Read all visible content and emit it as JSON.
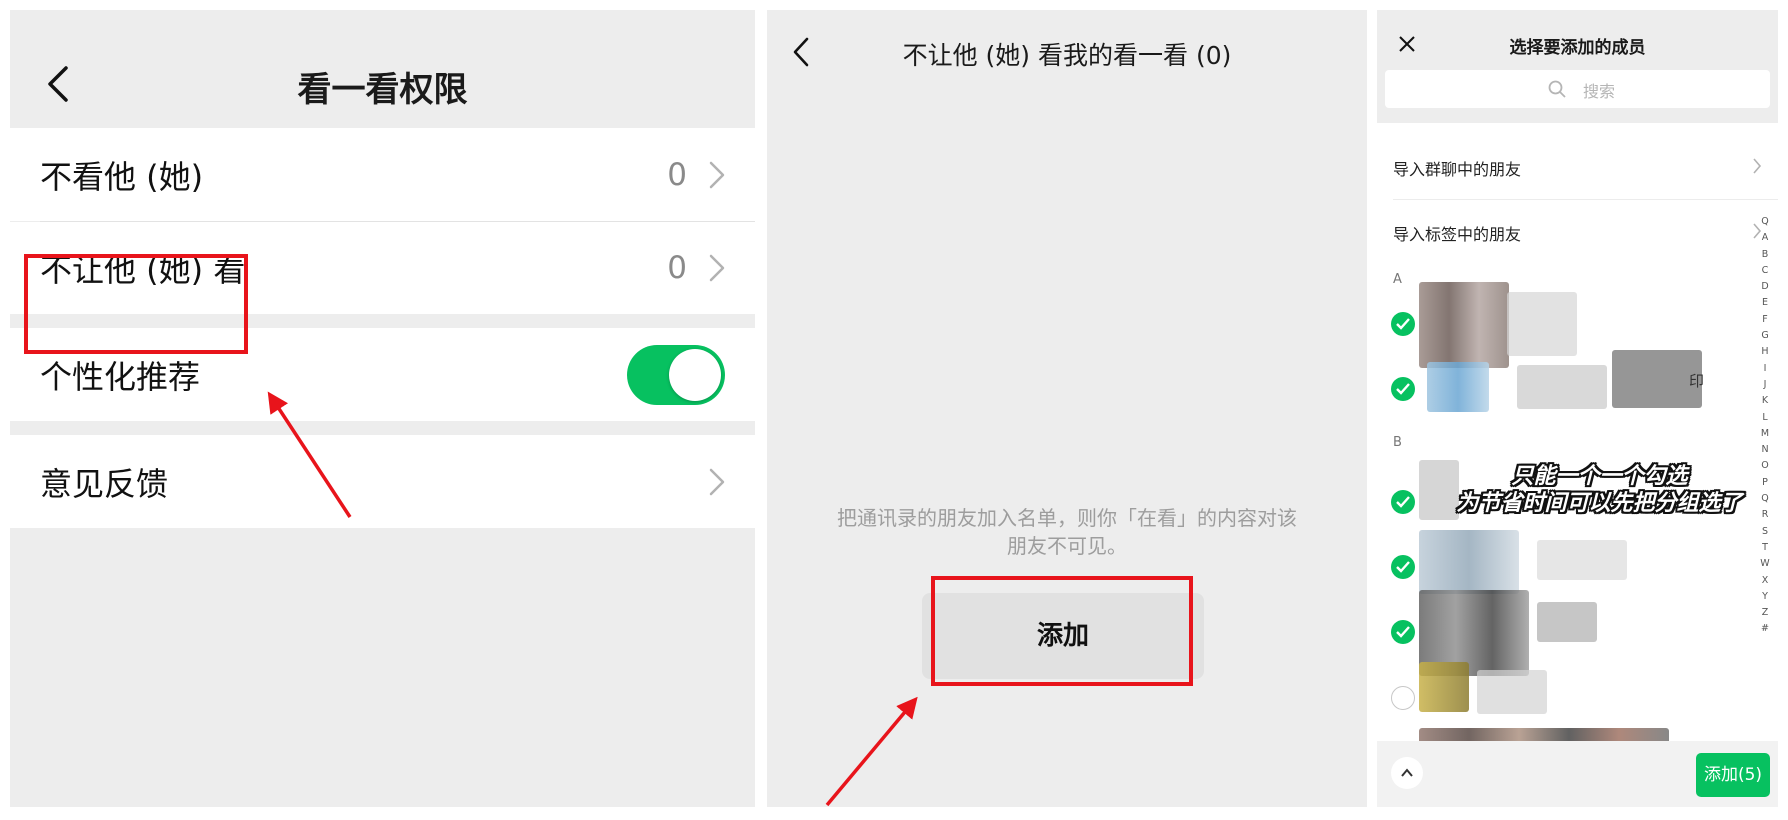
{
  "colors": {
    "wechat_green": "#07c160",
    "highlight_red": "#e8141b",
    "panel_bg": "#ededed"
  },
  "panel1": {
    "title": "看一看权限",
    "rows": [
      {
        "label": "不看他 (她)",
        "count": "0"
      },
      {
        "label": "不让他 (她) 看",
        "count": "0"
      },
      {
        "label": "个性化推荐",
        "toggle_on": true
      },
      {
        "label": "意见反馈"
      }
    ]
  },
  "panel2": {
    "title": "不让他 (她) 看我的看一看 (0)",
    "description_line1": "把通讯录的朋友加入名单，则你「在看」的内容对该",
    "description_line2": "朋友不可见。",
    "add_button": "添加"
  },
  "panel3": {
    "title": "选择要添加的成员",
    "search_placeholder": "搜索",
    "rows": [
      "导入群聊中的朋友",
      "导入标签中的朋友"
    ],
    "sections": [
      "A",
      "B"
    ],
    "partial_name": "印",
    "index_letters": [
      "Q",
      "A",
      "B",
      "C",
      "D",
      "E",
      "F",
      "G",
      "H",
      "I",
      "J",
      "K",
      "L",
      "M",
      "N",
      "O",
      "P",
      "Q",
      "R",
      "S",
      "T",
      "W",
      "X",
      "Y",
      "Z",
      "#"
    ],
    "overlay_line1": "只能一个一个勾选",
    "overlay_line2": "为节省时间可以先把分组选了",
    "confirm_button": "添加(5)",
    "icons": [
      "close-icon",
      "search-icon",
      "chevron-right-icon",
      "check-icon",
      "chevron-up-icon"
    ]
  }
}
